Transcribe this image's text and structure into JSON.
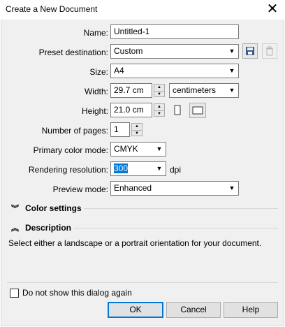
{
  "window": {
    "title": "Create a New Document",
    "close_glyph": "✕"
  },
  "form": {
    "name_label": "Name:",
    "name_value": "Untitled-1",
    "preset_label": "Preset destination:",
    "preset_value": "Custom",
    "size_label": "Size:",
    "size_value": "A4",
    "width_label": "Width:",
    "width_value": "29.7 cm",
    "units_value": "centimeters",
    "height_label": "Height:",
    "height_value": "21.0 cm",
    "pages_label": "Number of pages:",
    "pages_value": "1",
    "color_mode_label": "Primary color mode:",
    "color_mode_value": "CMYK",
    "resolution_label": "Rendering resolution:",
    "resolution_value": "300",
    "resolution_unit": "dpi",
    "preview_label": "Preview mode:",
    "preview_value": "Enhanced"
  },
  "sections": {
    "color_settings": "Color settings",
    "description": "Description",
    "description_text": "Select either a landscape or a portrait orientation for your document."
  },
  "footer": {
    "dont_show_label": "Do not show this dialog again",
    "dont_show_checked": false,
    "ok_label": "OK",
    "cancel_label": "Cancel",
    "help_label": "Help"
  },
  "icons": {
    "save": "save-preset-icon",
    "delete": "delete-preset-icon",
    "portrait": "portrait-orientation-icon",
    "landscape": "landscape-orientation-icon",
    "expand": "chevron-double-down-icon",
    "collapse": "chevron-double-up-icon"
  },
  "colors": {
    "accent": "#0078d7",
    "dialog_bg": "#f0f0f0"
  }
}
